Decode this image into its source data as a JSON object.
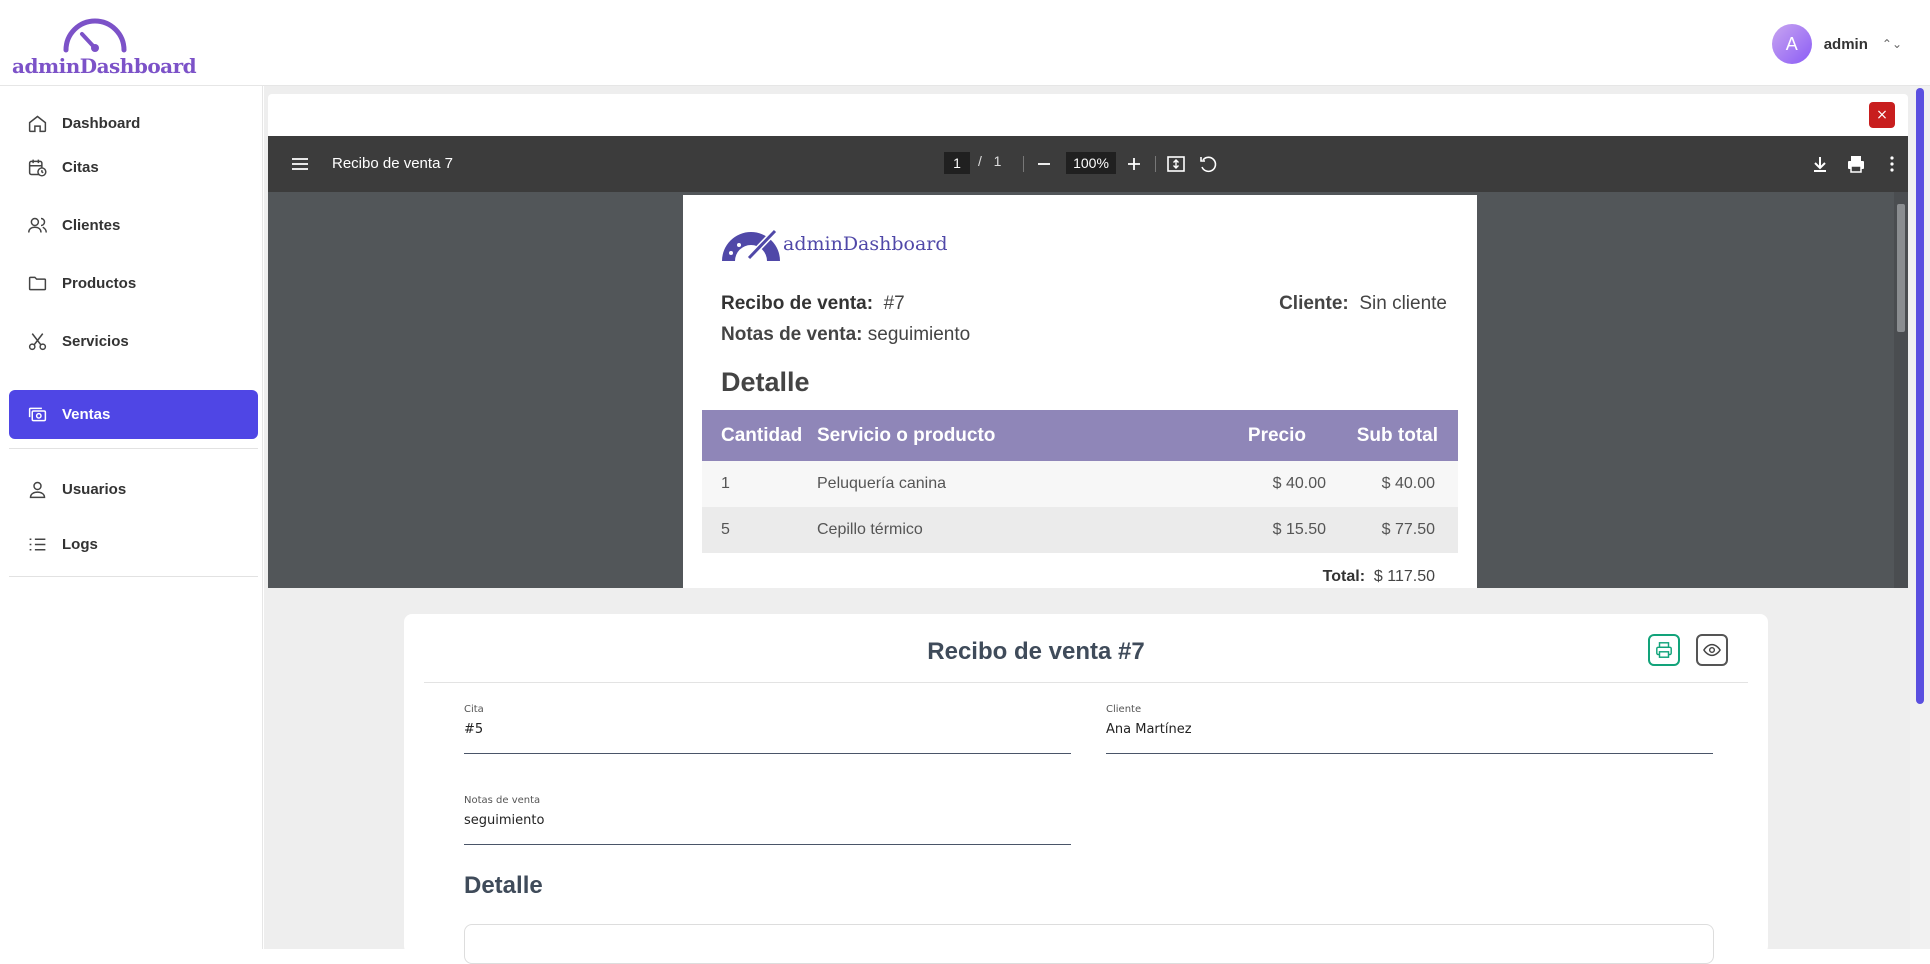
{
  "header": {
    "logo_text": "adminDashboard",
    "user_initial": "A",
    "user_name": "admin"
  },
  "sidebar": {
    "items": [
      {
        "label": "Dashboard",
        "icon": "home-icon",
        "active": false
      },
      {
        "label": "Citas",
        "icon": "calendar-clock-icon",
        "active": false
      },
      {
        "label": "Clientes",
        "icon": "users-icon",
        "active": false
      },
      {
        "label": "Productos",
        "icon": "folder-icon",
        "active": false
      },
      {
        "label": "Servicios",
        "icon": "scissors-icon",
        "active": false
      },
      {
        "label": "Ventas",
        "icon": "cash-icon",
        "active": true
      },
      {
        "label": "Usuarios",
        "icon": "user-icon",
        "active": false
      },
      {
        "label": "Logs",
        "icon": "list-icon",
        "active": false
      }
    ]
  },
  "pdf_viewer": {
    "close_label": "×",
    "title": "Recibo de venta 7",
    "page_current": "1",
    "page_separator": "/",
    "page_total": "1",
    "zoom": "100%",
    "document": {
      "logo_text": "adminDashboard",
      "receipt_label": "Recibo de venta:",
      "receipt_value": "#7",
      "client_label": "Cliente:",
      "client_value": "Sin cliente",
      "notes_label": "Notas de venta:",
      "notes_value": "seguimiento",
      "detail_heading": "Detalle",
      "table": {
        "headers": [
          "Cantidad",
          "Servicio o producto",
          "Precio",
          "Sub total"
        ],
        "rows": [
          [
            "1",
            "Peluquería canina",
            "$ 40.00",
            "$ 40.00"
          ],
          [
            "5",
            "Cepillo térmico",
            "$ 15.50",
            "$ 77.50"
          ]
        ]
      },
      "total_label": "Total:",
      "total_value": "$ 117.50"
    }
  },
  "form": {
    "title": "Recibo de venta #7",
    "cita_label": "Cita",
    "cita_value": "#5",
    "cliente_label": "Cliente",
    "cliente_value": "Ana Martínez",
    "notas_label": "Notas de venta",
    "notas_value": "seguimiento",
    "detail_heading": "Detalle"
  },
  "colors": {
    "accent": "#4f46e5",
    "brand": "#7c52c8",
    "close": "#c81e1e",
    "print_button": "#12a37a"
  }
}
